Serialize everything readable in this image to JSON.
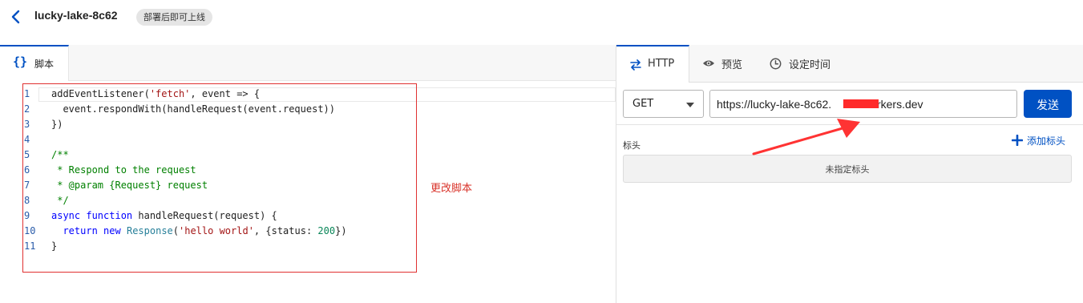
{
  "header": {
    "worker_name": "lucky-lake-8c62",
    "deploy_badge": "部署后即可上线"
  },
  "editor": {
    "tab_label": "脚本",
    "tab_icon": "braces-icon",
    "line_numbers": [
      "1",
      "2",
      "3",
      "4",
      "5",
      "6",
      "7",
      "8",
      "9",
      "10",
      "11"
    ],
    "code": {
      "l1_a": "addEventListener(",
      "l1_b": "'fetch'",
      "l1_c": ", event => {",
      "l2": "  event.respondWith(handleRequest(event.request))",
      "l3": "})",
      "l5": "/**",
      "l6": " * Respond to the request",
      "l7": " * @param {Request} request",
      "l8": " */",
      "l9_a": "async",
      "l9_b": " ",
      "l9_c": "function",
      "l9_d": " handleRequest(request) {",
      "l10_a": "  ",
      "l10_b": "return",
      "l10_c": " ",
      "l10_d": "new",
      "l10_e": " ",
      "l10_f": "Response",
      "l10_g": "(",
      "l10_h": "'hello world'",
      "l10_i": ", {status: ",
      "l10_j": "200",
      "l10_k": "})",
      "l11": "}"
    },
    "annotation": "更改脚本"
  },
  "request": {
    "tabs": [
      {
        "label": "HTTP",
        "icon": "swap-arrows-icon"
      },
      {
        "label": "预览",
        "icon": "eye-icon"
      },
      {
        "label": "设定时间",
        "icon": "clock-icon"
      }
    ],
    "method": "GET",
    "url": "https://lucky-lake-8c62.          workers.dev",
    "send_label": "发送",
    "headers_label": "标头",
    "add_header_label": "添加标头",
    "no_headers_label": "未指定标头"
  },
  "colors": {
    "accent": "#0051c3",
    "annotation_red": "#e03131"
  }
}
